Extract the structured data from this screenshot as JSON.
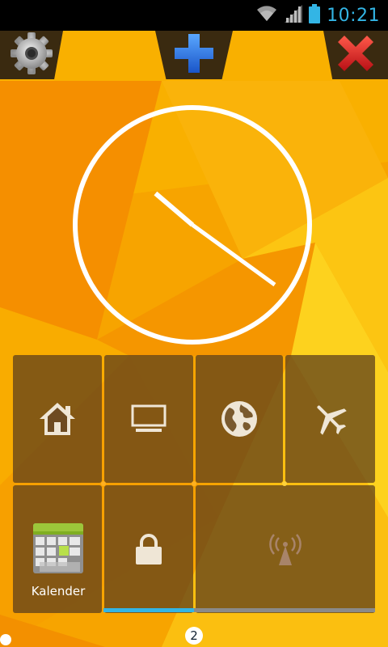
{
  "status_bar": {
    "time": "10:21",
    "icons": [
      "wifi-icon",
      "signal-icon",
      "battery-icon"
    ],
    "accent_color": "#33b5e5"
  },
  "top_bar": {
    "buttons": [
      {
        "name": "settings",
        "icon": "gear-icon"
      },
      {
        "name": "add",
        "icon": "plus-icon",
        "color": "#2f7de1"
      },
      {
        "name": "close",
        "icon": "close-icon",
        "color": "#e0242a"
      }
    ]
  },
  "clock": {
    "hour": 10,
    "minute": 21,
    "color": "#ffffff"
  },
  "toggles": {
    "row1": [
      {
        "icon": "home-icon"
      },
      {
        "icon": "monitor-icon"
      },
      {
        "icon": "globe-icon"
      },
      {
        "icon": "airplane-icon"
      }
    ],
    "row2": [
      {
        "icon": "calendar-icon",
        "label": "Kalender"
      },
      {
        "icon": "lock-icon"
      },
      {
        "icon": "hotspot-icon"
      }
    ],
    "progress": 0.25,
    "progress_color": "#33b5e5"
  },
  "page_indicator": {
    "value": "2"
  }
}
